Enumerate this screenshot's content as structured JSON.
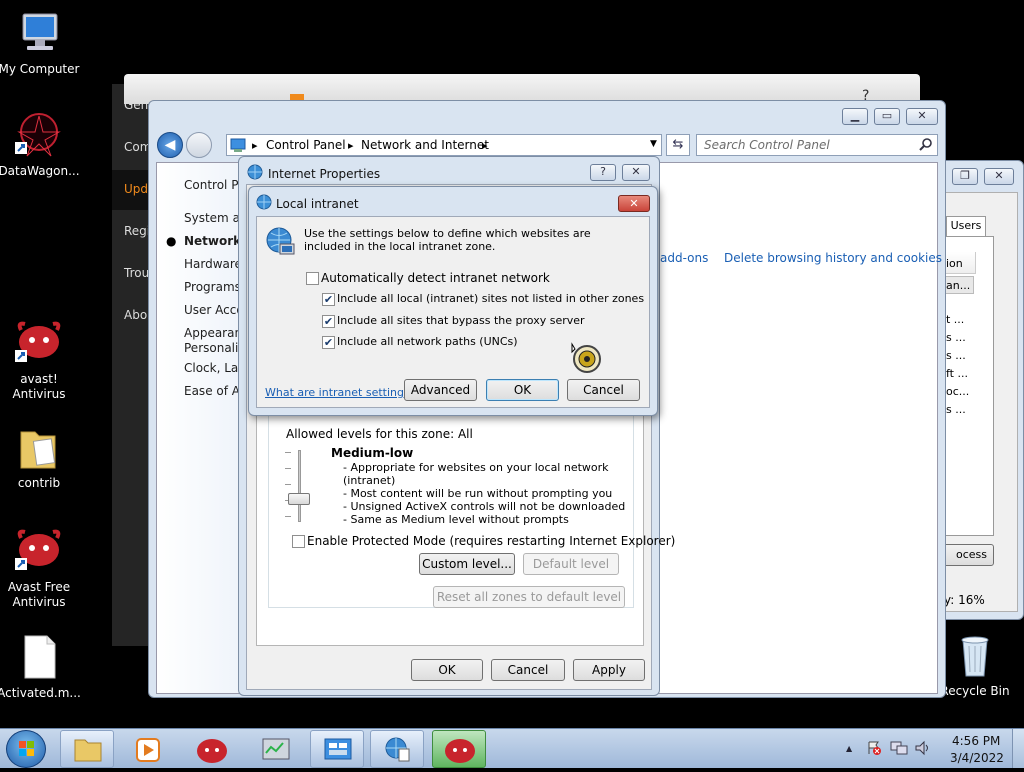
{
  "desktop": {
    "icons": [
      {
        "label": "My Computer"
      },
      {
        "label": "DataWagon..."
      },
      {
        "label": "avast! Antivirus"
      },
      {
        "label": "contrib"
      },
      {
        "label": "Avast Free Antivirus"
      },
      {
        "label": "Activated.m..."
      },
      {
        "label": "Recycle Bin"
      }
    ]
  },
  "back_window": {
    "sidebar_items": [
      "Gen",
      "Com",
      "Upd",
      "Regi",
      "Trou",
      "Abo"
    ],
    "help": "?"
  },
  "control_panel": {
    "breadcrumb": [
      "Control Panel",
      "Network and Internet"
    ],
    "search_placeholder": "Search Control Panel",
    "nav": [
      "Control Pa",
      "System an",
      "Network a",
      "Hardware",
      "Programs",
      "User Acco",
      "Appearanc",
      "Personaliz",
      "Clock, Lan",
      "Ease of Ac"
    ],
    "links": [
      "add-ons",
      "Delete browsing history and cookies"
    ]
  },
  "task_manager": {
    "tab": "Users",
    "col_header": "ion",
    "rows": [
      "an...",
      "t ...",
      "s ...",
      "s ...",
      "ft ...",
      "oc...",
      "s ..."
    ],
    "button": "ocess",
    "status": "y: 16%"
  },
  "internet_properties": {
    "title": "Internet Properties",
    "help": "?",
    "close": "✕",
    "allowed_levels": "Allowed levels for this zone: All",
    "level_title": "Medium-low",
    "level_lines": [
      "- Appropriate for websites on your local network",
      "(intranet)",
      "- Most content will be run without prompting you",
      "- Unsigned ActiveX controls will not be downloaded",
      "- Same as Medium level without prompts"
    ],
    "protected_mode": "Enable Protected Mode (requires restarting Internet Explorer)",
    "protected_mode_checked": false,
    "custom_level": "Custom level...",
    "default_level": "Default level",
    "reset_all": "Reset all zones to default level",
    "ok": "OK",
    "cancel": "Cancel",
    "apply": "Apply"
  },
  "local_intranet": {
    "title": "Local intranet",
    "close": "✕",
    "description": "Use the settings below to define which websites are included in the local intranet zone.",
    "options": [
      {
        "label": "Automatically detect intranet network",
        "checked": false
      },
      {
        "label": "Include all local (intranet) sites not listed in other zones",
        "checked": true
      },
      {
        "label": "Include all sites that bypass the proxy server",
        "checked": true
      },
      {
        "label": "Include all network paths (UNCs)",
        "checked": true
      }
    ],
    "help_link": "What are intranet settings?",
    "advanced": "Advanced",
    "ok": "OK",
    "cancel": "Cancel"
  },
  "taskbar": {
    "time": "4:56 PM",
    "date": "3/4/2022",
    "tray_arrow": "▲"
  },
  "colors": {
    "window_frame": "#d9e4f1",
    "close_red": "#c9443a",
    "link_blue": "#1a5fb4"
  }
}
